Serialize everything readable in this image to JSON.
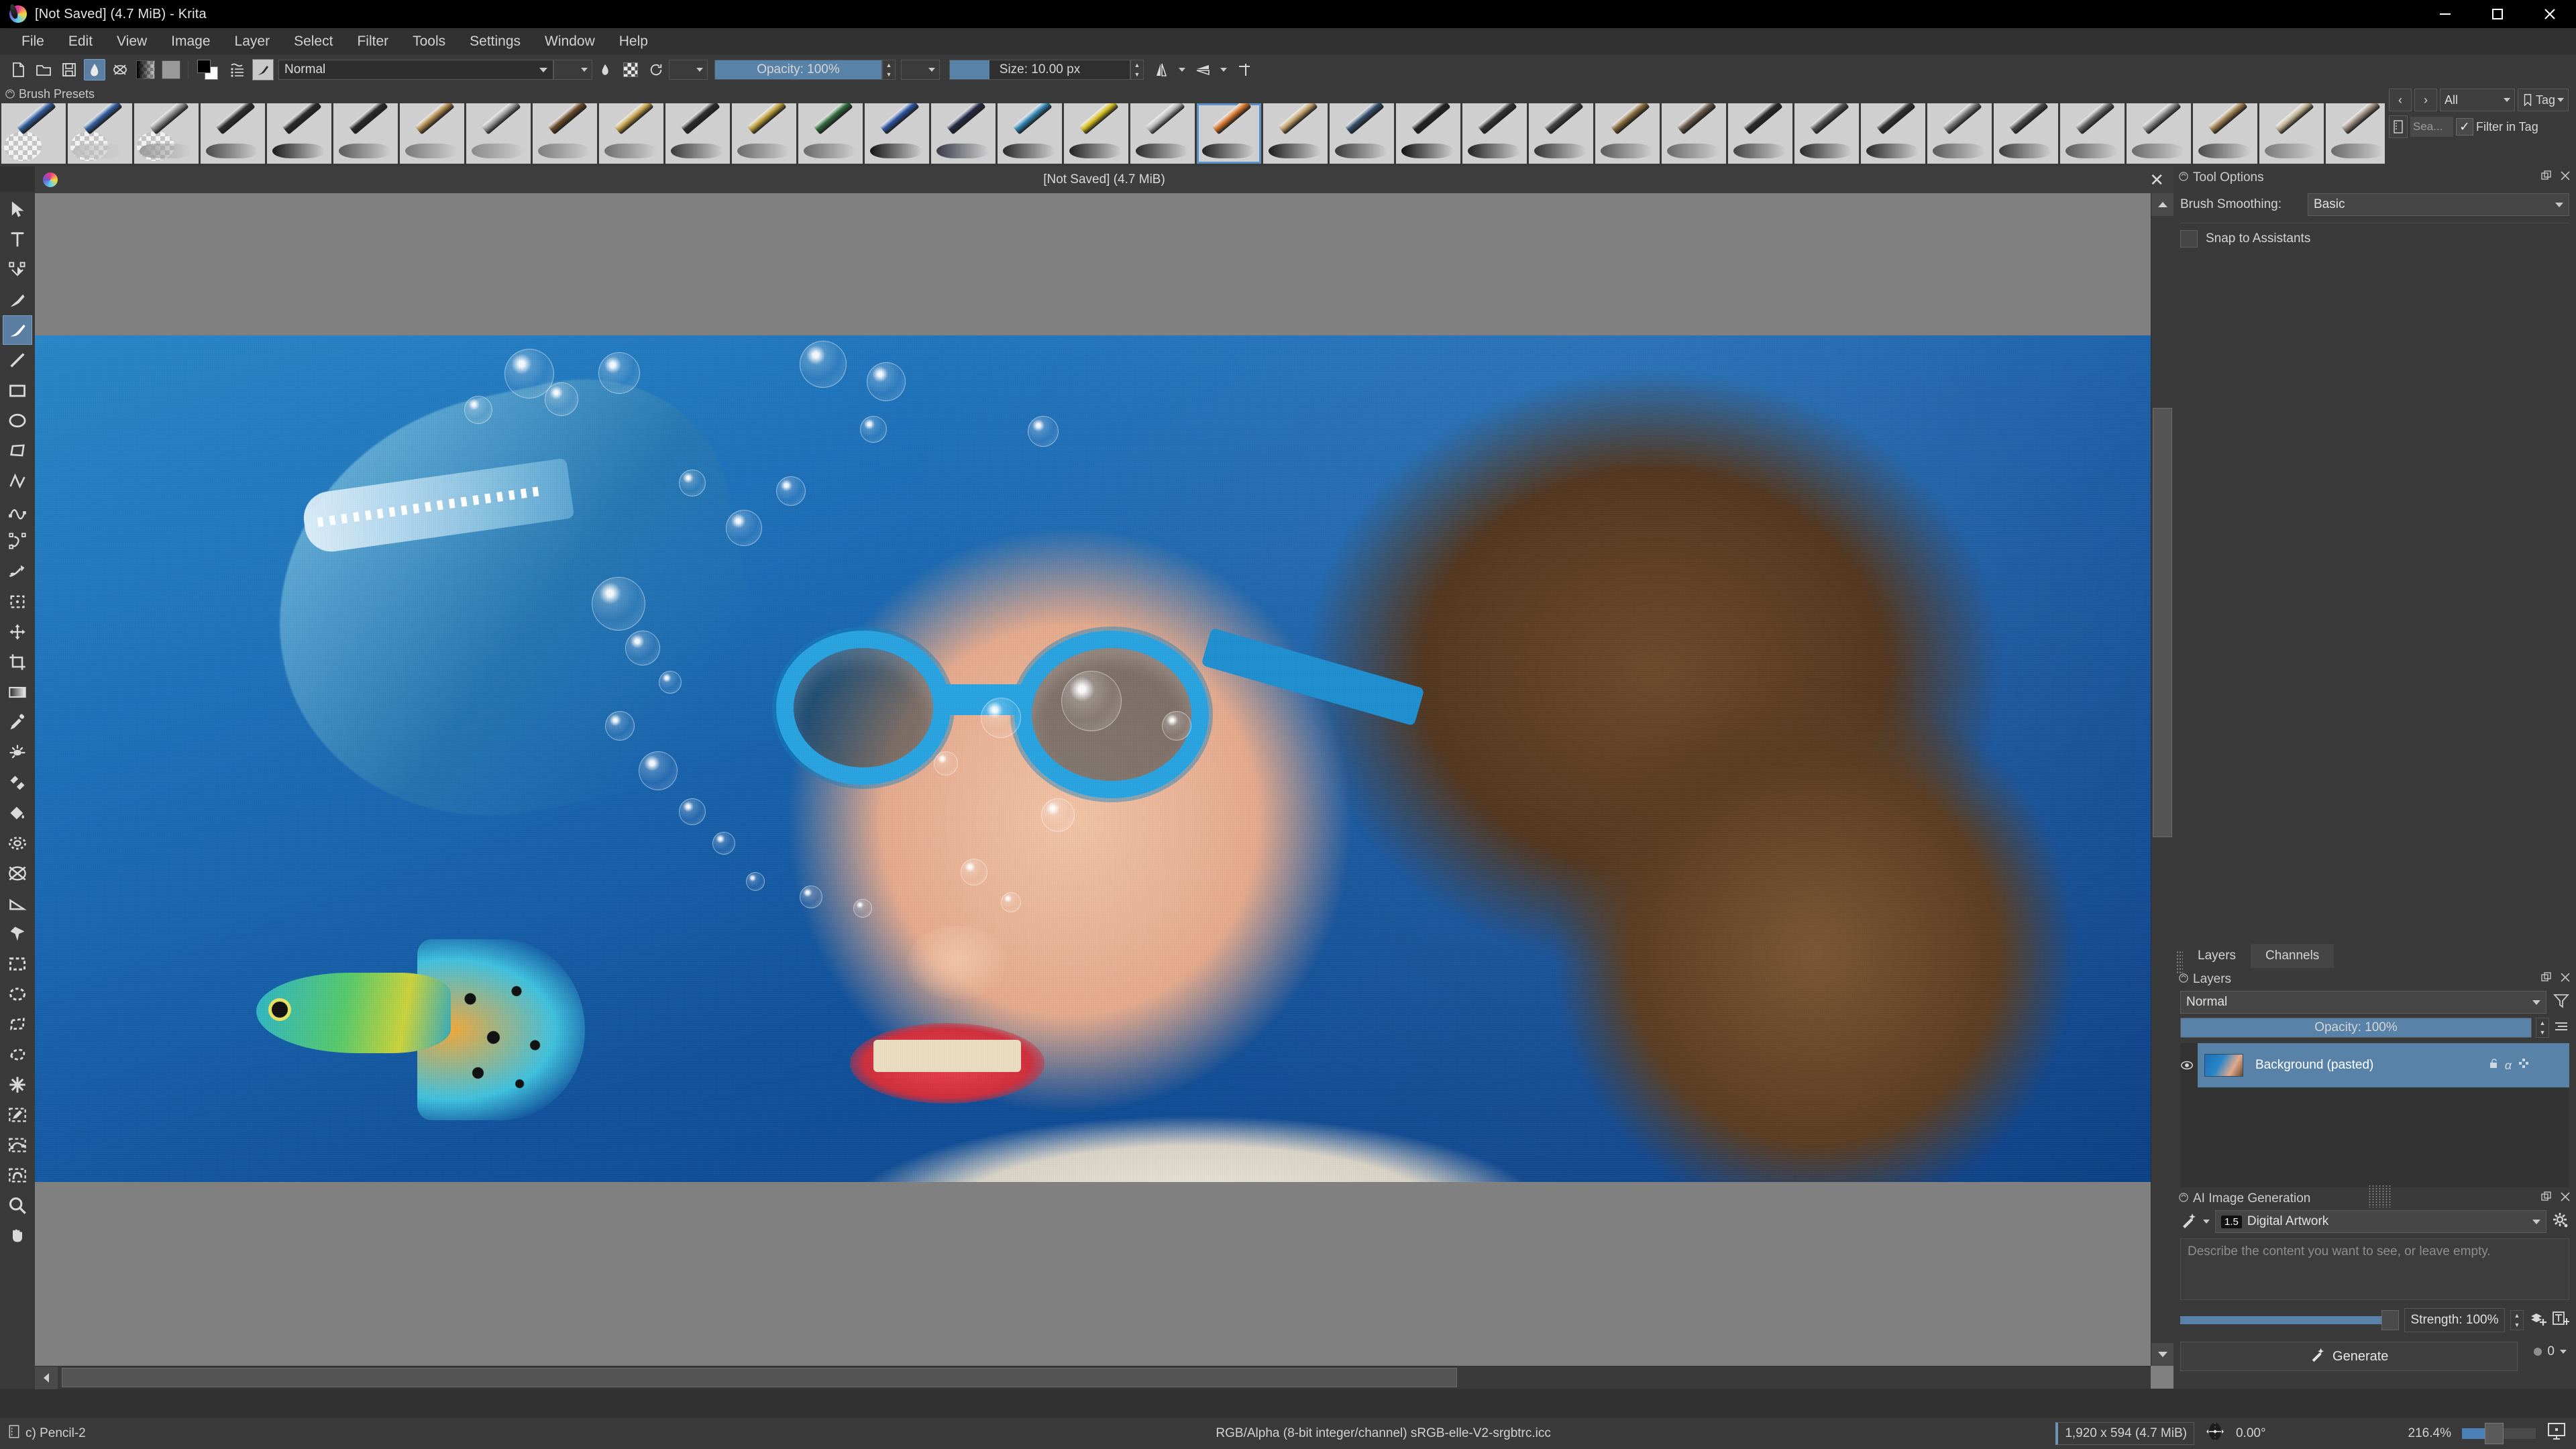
{
  "window": {
    "title": "[Not Saved]  (4.7 MiB)  - Krita",
    "app_icon": "krita-logo-icon",
    "controls": [
      {
        "name": "minimize-button",
        "glyph": "minimize-icon"
      },
      {
        "name": "maximize-button",
        "glyph": "maximize-icon"
      },
      {
        "name": "close-button",
        "glyph": "close-icon"
      }
    ]
  },
  "menubar": {
    "items": [
      "File",
      "Edit",
      "View",
      "Image",
      "Layer",
      "Select",
      "Filter",
      "Tools",
      "Settings",
      "Window",
      "Help"
    ]
  },
  "toolbar": {
    "icons": [
      {
        "name": "new-document-icon",
        "title": "New"
      },
      {
        "name": "open-document-icon",
        "title": "Open"
      },
      {
        "name": "save-document-icon",
        "title": "Save"
      },
      {
        "name": "gradient-tool-icon",
        "title": "Gradients"
      },
      {
        "name": "patterns-icon",
        "title": "Patterns"
      }
    ],
    "gradient_swatch": "gradient-swatch-icon",
    "pattern_swatch": "pattern-swatch-icon",
    "fgbg_swatch": "foreground-background-color-icon",
    "preset_history_icon": "brush-preset-history-icon",
    "brush_editor_icon": "brush-editor-icon",
    "blending_mode": "Normal",
    "opacity_label": "Opacity: 100%",
    "opacity_value": 100,
    "size_label": "Size: 10.00 px",
    "size_value": 10,
    "mirror_h_icon": "mirror-horizontal-icon",
    "mirror_v_icon": "mirror-vertical-icon",
    "wraparound_icon": "wraparound-mode-icon"
  },
  "brush_presets": {
    "dock_title": "Brush Presets",
    "selected_index": 18,
    "thumbnails": [
      {
        "name": "eraser-soft",
        "tip": "#2f5d9e",
        "stroke": "transparent",
        "checker": true
      },
      {
        "name": "eraser-small",
        "tip": "#2f5d9e",
        "stroke": "#bdbdbd",
        "checker": true
      },
      {
        "name": "airbrush-soft",
        "tip": "#8d8d8d",
        "stroke": "#9a9a9a",
        "checker": true
      },
      {
        "name": "marker-chisel",
        "tip": "#303030",
        "stroke": "#4a4a4a",
        "checker": false
      },
      {
        "name": "ink-pen-a",
        "tip": "#2a2a2a",
        "stroke": "#1a1a1a",
        "checker": false
      },
      {
        "name": "ink-pen-b",
        "tip": "#2a2a2a",
        "stroke": "#5a5a5a",
        "checker": false
      },
      {
        "name": "ink-pen-c",
        "tip": "#b08a4a",
        "stroke": "#7a7a7a",
        "checker": false
      },
      {
        "name": "ink-pen-d",
        "tip": "#9a9a9a",
        "stroke": "#8a8a8a",
        "checker": false
      },
      {
        "name": "pencil-hard",
        "tip": "#6c4a28",
        "stroke": "#7d7d7d",
        "checker": false
      },
      {
        "name": "pencil-soft",
        "tip": "#c6a24a",
        "stroke": "#6f6f6f",
        "checker": false
      },
      {
        "name": "charcoal",
        "tip": "#2c2c2c",
        "stroke": "#3a3a3a",
        "checker": false
      },
      {
        "name": "pencil-tilt",
        "tip": "#c0a03a",
        "stroke": "#6a6a6a",
        "checker": false
      },
      {
        "name": "pencil-green",
        "tip": "#2f6b3a",
        "stroke": "#6a6a6a",
        "checker": false
      },
      {
        "name": "fountain-pen-blue",
        "tip": "#2a52a0",
        "stroke": "#151515",
        "checker": false
      },
      {
        "name": "ballpoint-pen",
        "tip": "#232a45",
        "stroke": "#3a3a4a",
        "checker": false
      },
      {
        "name": "mechanical-pencil",
        "tip": "#2f86b5",
        "stroke": "#2a2a2a",
        "checker": false
      },
      {
        "name": "yellow-pen",
        "tip": "#d8c020",
        "stroke": "#222",
        "checker": false
      },
      {
        "name": "nib-pen",
        "tip": "#b5b5b5",
        "stroke": "#2a2a2a",
        "checker": false
      },
      {
        "name": "sketch-brush",
        "tip": "#d8762a",
        "stroke": "#222",
        "checker": false
      },
      {
        "name": "bristle-brush",
        "tip": "#c4a168",
        "stroke": "#1d1d1d",
        "checker": false
      },
      {
        "name": "rotate-brush",
        "tip": "#35506e",
        "stroke": "#3a3a3a",
        "checker": false
      },
      {
        "name": "ink-brush-1",
        "tip": "#222",
        "stroke": "#111",
        "checker": false
      },
      {
        "name": "ink-brush-2",
        "tip": "#333",
        "stroke": "#222",
        "checker": false
      },
      {
        "name": "ink-brush-3",
        "tip": "#444",
        "stroke": "#333",
        "checker": false
      },
      {
        "name": "watercolor-1",
        "tip": "#8a6a3a",
        "stroke": "#5a5a5a",
        "checker": false
      },
      {
        "name": "watercolor-2",
        "tip": "#6a5a4a",
        "stroke": "#6a6a6a",
        "checker": false
      },
      {
        "name": "dry-brush",
        "tip": "#2a2a2a",
        "stroke": "#444",
        "checker": false
      },
      {
        "name": "fill-brush",
        "tip": "#555",
        "stroke": "#2a2a2a",
        "checker": false
      },
      {
        "name": "splatter-brush",
        "tip": "#333",
        "stroke": "#2a2a2a",
        "checker": false
      },
      {
        "name": "chalk-brush",
        "tip": "#7a7a7a",
        "stroke": "#5a5a5a",
        "checker": false
      },
      {
        "name": "texture-brush",
        "tip": "#4a4a4a",
        "stroke": "#3a3a3a",
        "checker": false
      },
      {
        "name": "smudge-brush",
        "tip": "#6a6a6a",
        "stroke": "#5a5a5a",
        "checker": false
      },
      {
        "name": "blender-brush",
        "tip": "#8a8a8a",
        "stroke": "#6a6a6a",
        "checker": false
      },
      {
        "name": "marker-brush",
        "tip": "#a08050",
        "stroke": "#4a4a4a",
        "checker": false
      },
      {
        "name": "pastel-brush",
        "tip": "#c0b090",
        "stroke": "#7a7a7a",
        "checker": false
      },
      {
        "name": "sponge-brush",
        "tip": "#9a8a7a",
        "stroke": "#6a6a6a",
        "checker": false
      },
      {
        "name": "spray-brush",
        "tip": "#8a8a9a",
        "stroke": "#5a5a5a",
        "checker": false
      },
      {
        "name": "deform-brush",
        "tip": "#5a6a7a",
        "stroke": "#4a4a4a",
        "checker": false
      }
    ],
    "prev_label": "‹",
    "next_label": "›",
    "tag_filter": "All",
    "tag_button": "Tag",
    "search_placeholder": "Sea...",
    "filter_in_tag_label": "Filter in Tag",
    "filter_in_tag_checked": true
  },
  "tools": [
    {
      "name": "select-shapes-tool",
      "icon": "cursor-arrow-icon",
      "selected": false
    },
    {
      "name": "text-tool",
      "icon": "text-t-icon",
      "selected": false
    },
    {
      "name": "edit-shapes-tool",
      "icon": "node-edit-icon",
      "selected": false
    },
    {
      "name": "calligraphy-tool",
      "icon": "calligraphy-pen-icon",
      "selected": false
    },
    {
      "name": "freehand-brush-tool",
      "icon": "paintbrush-icon",
      "selected": true
    },
    {
      "name": "line-tool",
      "icon": "line-icon",
      "selected": false
    },
    {
      "name": "rectangle-tool",
      "icon": "rectangle-icon",
      "selected": false
    },
    {
      "name": "ellipse-tool",
      "icon": "ellipse-icon",
      "selected": false
    },
    {
      "name": "polygon-tool",
      "icon": "polygon-icon",
      "selected": false
    },
    {
      "name": "polyline-tool",
      "icon": "polyline-icon",
      "selected": false
    },
    {
      "name": "bezier-curve-tool",
      "icon": "bezier-curve-icon",
      "selected": false
    },
    {
      "name": "freehand-path-tool",
      "icon": "freehand-path-icon",
      "selected": false
    },
    {
      "name": "dynamic-brush-tool",
      "icon": "dynamic-brush-icon",
      "selected": false
    },
    {
      "name": "transform-tool",
      "icon": "transform-icon",
      "selected": false
    },
    {
      "name": "move-tool",
      "icon": "move-arrows-icon",
      "selected": false
    },
    {
      "name": "crop-tool",
      "icon": "crop-icon",
      "selected": false
    },
    {
      "name": "gradient-tool",
      "icon": "gradient-icon",
      "selected": false
    },
    {
      "name": "color-picker-tool",
      "icon": "eyedropper-icon",
      "selected": false
    },
    {
      "name": "colorize-mask-tool",
      "icon": "colorize-mask-icon",
      "selected": false
    },
    {
      "name": "smart-patch-tool",
      "icon": "smart-patch-icon",
      "selected": false
    },
    {
      "name": "fill-tool",
      "icon": "paint-bucket-icon",
      "selected": false
    },
    {
      "name": "enclose-and-fill-tool",
      "icon": "enclose-fill-icon",
      "selected": false
    },
    {
      "name": "gradient-edit-tool",
      "icon": "gradient-edit-icon",
      "selected": false
    },
    {
      "name": "measure-tool",
      "icon": "measure-ruler-icon",
      "selected": false
    },
    {
      "name": "assistant-tool",
      "icon": "assistant-pin-icon",
      "selected": false
    },
    {
      "name": "rectangular-selection-tool",
      "icon": "rect-select-icon",
      "selected": false
    },
    {
      "name": "elliptical-selection-tool",
      "icon": "ellipse-select-icon",
      "selected": false
    },
    {
      "name": "polygonal-selection-tool",
      "icon": "polygon-select-icon",
      "selected": false
    },
    {
      "name": "freehand-selection-tool",
      "icon": "lasso-select-icon",
      "selected": false
    },
    {
      "name": "contiguous-selection-tool",
      "icon": "magic-wand-icon",
      "selected": false
    },
    {
      "name": "similar-color-selection-tool",
      "icon": "similar-color-select-icon",
      "selected": false
    },
    {
      "name": "bezier-selection-tool",
      "icon": "bezier-select-icon",
      "selected": false
    },
    {
      "name": "magnetic-selection-tool",
      "icon": "magnetic-select-icon",
      "selected": false
    },
    {
      "name": "zoom-tool",
      "icon": "magnifier-icon",
      "selected": false
    },
    {
      "name": "pan-tool",
      "icon": "hand-pan-icon",
      "selected": false
    }
  ],
  "canvas": {
    "subwindow_title": "[Not Saved]  (4.7 MiB)",
    "close_label": "✕",
    "document_icon": "krita-document-icon"
  },
  "tool_options": {
    "dock_title": "Tool Options",
    "brush_smoothing_label": "Brush Smoothing:",
    "brush_smoothing_value": "Basic",
    "snap_to_assistants_label": "Snap to Assistants",
    "snap_to_assistants_checked": false,
    "float_icon": "undock-icon",
    "close_icon": "close-icon"
  },
  "layers_panel": {
    "tabs": [
      {
        "label": "Layers",
        "active": true
      },
      {
        "label": "Channels",
        "active": false
      }
    ],
    "dock_title": "Layers",
    "blending_mode": "Normal",
    "opacity_label": "Opacity:  100%",
    "opacity_value": 100,
    "filter_icon": "funnel-filter-icon",
    "properties_icon": "layer-properties-icon",
    "rows": [
      {
        "name": "Background (pasted)",
        "visible": true,
        "checked": true,
        "selected": true,
        "lock_icon": "lock-open-icon",
        "alpha_icon": "alpha-lock-icon",
        "move_icon": "move-layer-icon"
      }
    ],
    "buttons": [
      {
        "name": "add-layer-button",
        "icon": "plus-icon"
      },
      {
        "name": "add-layer-menu-button",
        "icon": "chevron-down-icon"
      },
      {
        "name": "duplicate-layer-button",
        "icon": "duplicate-icon"
      },
      {
        "name": "move-layer-down-button",
        "icon": "chevron-down-icon"
      },
      {
        "name": "move-layer-up-button",
        "icon": "chevron-up-icon"
      },
      {
        "name": "layer-properties-button",
        "icon": "sliders-icon"
      },
      {
        "name": "layer-properties-menu-button",
        "icon": "chevron-down-icon"
      },
      {
        "name": "delete-layer-button",
        "icon": "trash-icon"
      }
    ]
  },
  "ai_panel": {
    "dock_title": "AI Image Generation",
    "style_badge": "1.5",
    "style_value": "Digital Artwork",
    "magic_icon": "magic-wand-sparkle-icon",
    "settings_icon": "gear-icon",
    "prompt_placeholder": "Describe the content you want to see, or leave empty.",
    "prompt_value": "",
    "strength_label": "Strength: 100%",
    "strength_value": 100,
    "add_layer_icon": "add-layer-stack-icon",
    "add_text_icon": "add-text-icon",
    "generate_label": "Generate",
    "queue_count": "0",
    "queue_dropdown_icon": "chevron-down-icon"
  },
  "statusbar": {
    "brush_preset": "c) Pencil-2",
    "preset_icon": "brush-preset-icon",
    "color_info": "RGB/Alpha (8-bit integer/channel)  sRGB-elle-V2-srgbtrc.icc",
    "dimensions": "1,920 x 594 (4.7 MiB)",
    "rotation": "0.00°",
    "rotation_icon": "canvas-rotation-icon",
    "zoom": "216.4%",
    "zoom_value": 216.4,
    "fit_icon": "fit-to-screen-icon"
  },
  "colors": {
    "accent": "#5882a8",
    "panel": "#3a3a3a",
    "panel_dark": "#333333",
    "titlebar": "#000000",
    "canvas_bg": "#808080",
    "text": "#d6d6d6"
  }
}
